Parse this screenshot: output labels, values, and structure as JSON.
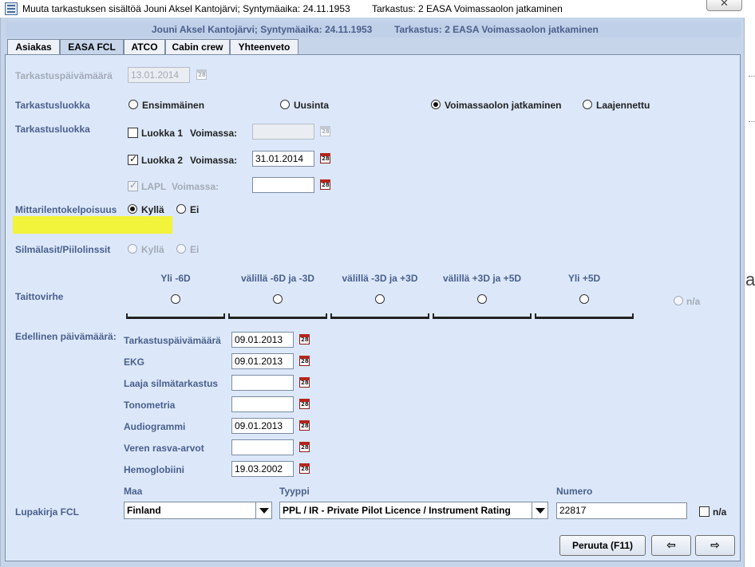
{
  "window": {
    "title": "Muuta tarkastuksen sisältöä Jouni Aksel Kantojärvi; Syntymäaika: 24.11.1953",
    "title_right": "Tarkastus: 2 EASA Voimassaolon jatkaminen",
    "close_glyph": "✕"
  },
  "header": {
    "left": "Jouni Aksel Kantojärvi; Syntymäaika: 24.11.1953",
    "right": "Tarkastus: 2 EASA Voimassaolon jatkaminen"
  },
  "tabs": [
    {
      "label": "Asiakas",
      "active": false
    },
    {
      "label": "EASA FCL",
      "active": true
    },
    {
      "label": "ATCO",
      "active": false
    },
    {
      "label": "Cabin crew",
      "active": false
    },
    {
      "label": "Yhteenveto",
      "active": false
    }
  ],
  "inspection_date": {
    "label": "Tarkastuspäivämäärä",
    "value": "13.01.2014"
  },
  "inspection_class": {
    "label": "Tarkastusluokka",
    "options": [
      "Ensimmäinen",
      "Uusinta",
      "Voimassaolon jatkaminen",
      "Laajennettu"
    ],
    "selected": "Voimassaolon jatkaminen"
  },
  "class_section": {
    "label": "Tarkastusluokka",
    "class1": {
      "label": "Luokka 1",
      "valid_label": "Voimassa:",
      "value": "",
      "checked": false
    },
    "class2": {
      "label": "Luokka 2",
      "valid_label": "Voimassa:",
      "value": "31.01.2014",
      "checked": true
    },
    "lapl": {
      "label": "LAPL",
      "valid_label": "Voimassa:",
      "value": "",
      "checked": true
    }
  },
  "instrument_rating": {
    "label": "Mittarilentokelpoisuus",
    "options": [
      "Kyllä",
      "Ei"
    ],
    "selected": "Kyllä"
  },
  "glasses": {
    "label": "Silmälasit/Piilolinssit",
    "options": [
      "Kyllä",
      "Ei"
    ]
  },
  "refraction": {
    "label": "Taittovirhe",
    "columns": [
      "Yli -6D",
      "välillä -6D ja -3D",
      "välillä -3D ja +3D",
      "välillä +3D ja +5D",
      "Yli +5D"
    ],
    "na_label": "n/a"
  },
  "previous_dates": {
    "label": "Edellinen päivämäärä:",
    "rows": [
      {
        "label": "Tarkastuspäivämäärä",
        "value": "09.01.2013"
      },
      {
        "label": "EKG",
        "value": "09.01.2013"
      },
      {
        "label": "Laaja silmätarkastus",
        "value": ""
      },
      {
        "label": "Tonometria",
        "value": ""
      },
      {
        "label": "Audiogrammi",
        "value": "09.01.2013"
      },
      {
        "label": "Veren rasva-arvot",
        "value": ""
      },
      {
        "label": "Hemoglobiini",
        "value": "19.03.2002"
      }
    ]
  },
  "licence": {
    "label": "Lupakirja FCL",
    "country_label": "Maa",
    "country_value": "Finland",
    "type_label": "Tyyppi",
    "type_value": "PPL / IR - Private Pilot Licence / Instrument Rating",
    "number_label": "Numero",
    "number_value": "22817",
    "na_label": "n/a"
  },
  "buttons": {
    "cancel": "Peruuta (F11)",
    "prev": "⇦",
    "next": "⇨"
  },
  "colors": {
    "label_blue": "#4a5f8c",
    "panel_bg": "#dce8fa",
    "highlight": "#f2f33b"
  }
}
